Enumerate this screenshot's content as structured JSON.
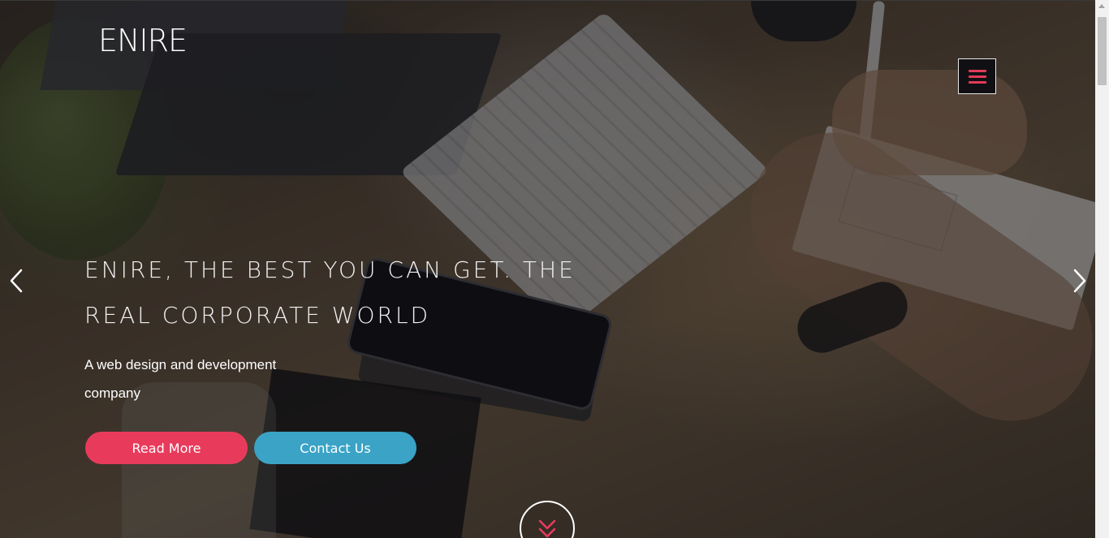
{
  "header": {
    "logo": "ENIRE",
    "menu_icon": "hamburger-icon"
  },
  "hero": {
    "headline": "ENIRE, THE BEST YOU CAN GET. THE REAL CORPORATE WORLD",
    "subtext": "A web design and development company",
    "read_more_label": "Read More",
    "contact_label": "Contact Us",
    "prev_icon": "chevron-left-icon",
    "next_icon": "chevron-right-icon",
    "scroll_icon": "double-chevron-down-icon"
  },
  "colors": {
    "accent_red": "#e83b5c",
    "accent_blue": "#3aa3c6",
    "text": "#ffffff"
  }
}
